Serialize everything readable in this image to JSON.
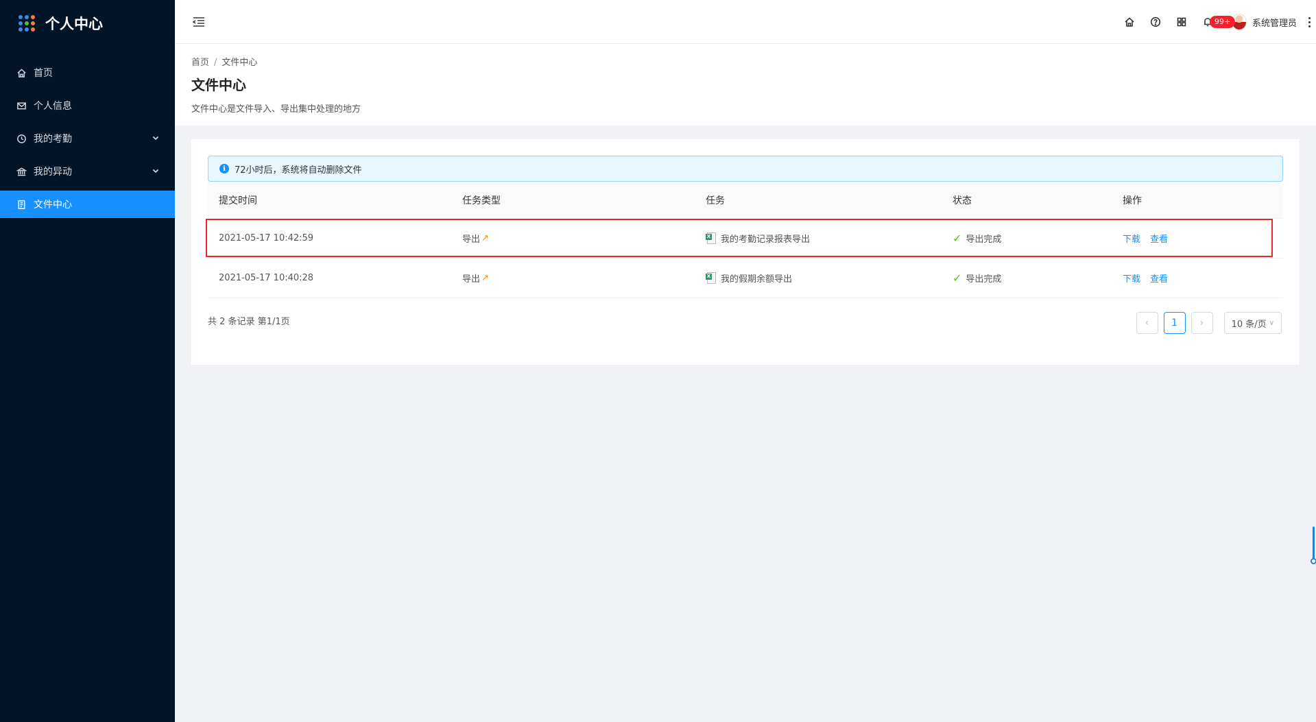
{
  "sidebar": {
    "title": "个人中心",
    "items": [
      {
        "label": "首页",
        "icon": "home-icon"
      },
      {
        "label": "个人信息",
        "icon": "mail-icon"
      },
      {
        "label": "我的考勤",
        "icon": "clock-icon",
        "expandable": true
      },
      {
        "label": "我的异动",
        "icon": "bank-icon",
        "expandable": true
      },
      {
        "label": "文件中心",
        "icon": "file-icon",
        "active": true
      }
    ]
  },
  "header": {
    "notification_badge": "99+",
    "user_name": "系统管理员"
  },
  "breadcrumb": {
    "home": "首页",
    "separator": "/",
    "current": "文件中心"
  },
  "page": {
    "title": "文件中心",
    "description": "文件中心是文件导入、导出集中处理的地方"
  },
  "alert": {
    "text": "72小时后，系统将自动删除文件"
  },
  "table": {
    "columns": [
      "提交时间",
      "任务类型",
      "任务",
      "状态",
      "操作"
    ],
    "rows": [
      {
        "time": "2021-05-17 10:42:59",
        "type": "导出",
        "task": "我的考勤记录报表导出",
        "status": "导出完成",
        "action_download": "下载",
        "action_view": "查看",
        "highlighted": true
      },
      {
        "time": "2021-05-17 10:40:28",
        "type": "导出",
        "task": "我的假期余额导出",
        "status": "导出完成",
        "action_download": "下载",
        "action_view": "查看",
        "highlighted": false
      }
    ]
  },
  "pagination": {
    "total_text": "共 2 条记录 第1/1页",
    "current_page": "1",
    "page_size": "10 条/页"
  },
  "colors": {
    "sidebar_bg": "#011428",
    "accent": "#1890ff",
    "highlight_border": "#e8262b",
    "success": "#52c41a"
  }
}
